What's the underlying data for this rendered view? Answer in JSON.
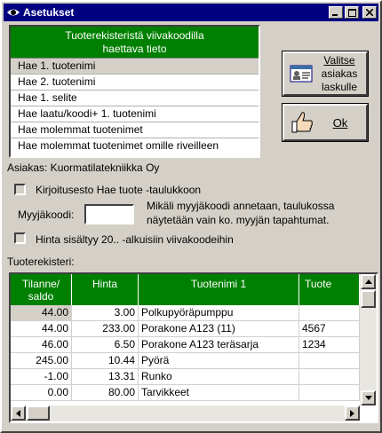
{
  "window": {
    "title": "Asetukset"
  },
  "list": {
    "header": "Tuoterekisteristä viivakoodilla\nhaettava tieto",
    "items": [
      "Hae 1. tuotenimi",
      "Hae 2. tuotenimi",
      "Hae 1. selite",
      "Hae laatu/koodi+ 1. tuotenimi",
      "Hae molemmat tuotenimet",
      "Hae molemmat tuotenimet omille riveilleen"
    ],
    "selected_index": 0
  },
  "buttons": {
    "choose_line1": "Valitse",
    "choose_line2": "asiakas",
    "choose_line3": "laskulle",
    "ok": "Ok"
  },
  "customer": "Asiakas: Kuormatilatekniikka Oy",
  "options": {
    "write_protect": "Kirjoitusesto Hae tuote -taulukkoon",
    "seller_code_label": "Myyjäkoodi:",
    "seller_code_value": "",
    "seller_note": "Mikäli myyjäkoodi annetaan, taulukossa\nnäytetään vain ko. myyjän tapahtumat.",
    "price_included": "Hinta sisältyy 20.. -alkuisiin viivakoodeihin"
  },
  "grid": {
    "label": "Tuoterekisteri:",
    "columns": [
      "Tilanne/\nsaldo",
      "Hinta",
      "Tuotenimi 1",
      "Tuote"
    ],
    "rows": [
      [
        "44.00",
        "3.00",
        "Polkupyöräpumppu",
        ""
      ],
      [
        "44.00",
        "233.00",
        "Porakone A123 (11)",
        "4567"
      ],
      [
        "46.00",
        "6.50",
        "Porakone A123 teräsarja",
        "1234"
      ],
      [
        "245.00",
        "10.44",
        "Pyörä",
        ""
      ],
      [
        "-1.00",
        "13.31",
        "Runko",
        ""
      ],
      [
        "0.00",
        "80.00",
        "Tarvikkeet",
        ""
      ]
    ]
  },
  "colors": {
    "title_bar": "#000080",
    "header_green": "#008000",
    "face": "#d4d0c8"
  },
  "icons": [
    "eye-icon",
    "minimize-icon",
    "maximize-icon",
    "close-icon",
    "id-card-icon",
    "thumbs-up-icon"
  ]
}
